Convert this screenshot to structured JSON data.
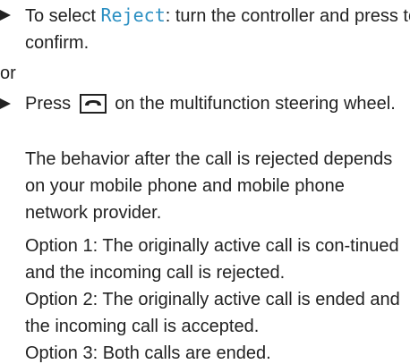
{
  "bullet1": {
    "pre": "To select ",
    "highlight": "Reject",
    "post": ": turn the controller and press to confirm."
  },
  "or_label": "or",
  "bullet2": {
    "pre": "Press ",
    "icon": "phone-hangup-icon",
    "post": " on the multifunction steering wheel."
  },
  "para1": "The behavior after the call is rejected depends on your mobile phone and mobile phone network provider.",
  "para2": "Option 1: The originally active call is con-tinued and the incoming call is rejected.",
  "para3": "Option 2: The originally active call is ended and the incoming call is accepted.",
  "para4": "Option 3: Both calls are ended.",
  "colors": {
    "text": "#222222",
    "highlight": "#2b8fc2"
  }
}
